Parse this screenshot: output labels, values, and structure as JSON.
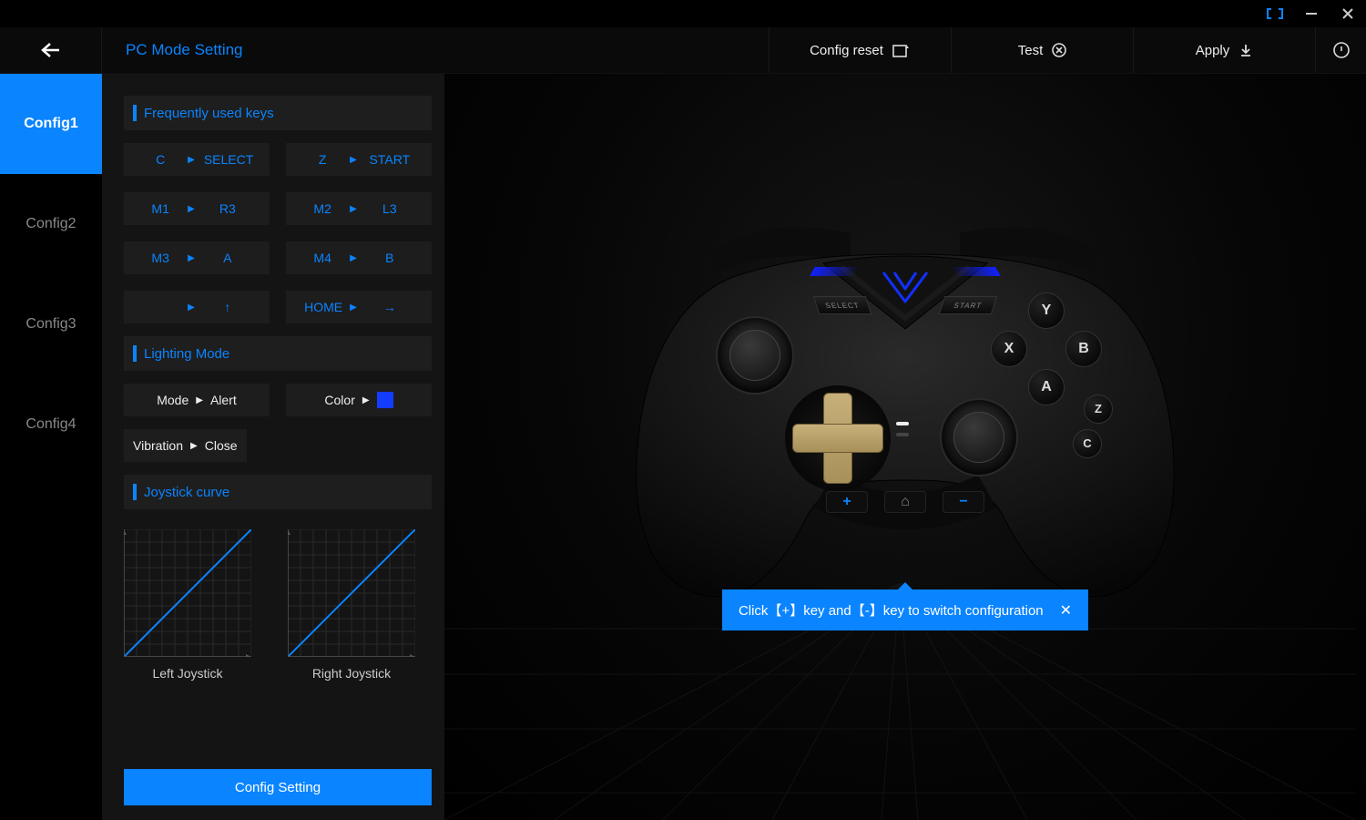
{
  "window": {
    "link_icon": "link-icon",
    "minimize_icon": "minimize-icon",
    "close_icon": "close-icon"
  },
  "header": {
    "title": "PC Mode Setting",
    "config_reset": "Config reset",
    "test": "Test",
    "apply": "Apply"
  },
  "tabs": [
    {
      "label": "Config1",
      "active": true
    },
    {
      "label": "Config2",
      "active": false
    },
    {
      "label": "Config3",
      "active": false
    },
    {
      "label": "Config4",
      "active": false
    }
  ],
  "sections": {
    "freq_keys": "Frequently used keys",
    "lighting": "Lighting Mode",
    "joystick": "Joystick curve"
  },
  "keymaps": [
    {
      "key": "C",
      "val": "SELECT"
    },
    {
      "key": "Z",
      "val": "START"
    },
    {
      "key": "M1",
      "val": "R3"
    },
    {
      "key": "M2",
      "val": "L3"
    },
    {
      "key": "M3",
      "val": "A"
    },
    {
      "key": "M4",
      "val": "B"
    },
    {
      "key": "",
      "val": "↑"
    },
    {
      "key": "HOME",
      "val": "→"
    }
  ],
  "lighting": {
    "mode_label": "Mode",
    "mode_value": "Alert",
    "color_label": "Color",
    "color_hex": "#143cff",
    "vibration_label": "Vibration",
    "vibration_value": "Close"
  },
  "curves": {
    "left_label": "Left Joystick",
    "right_label": "Right Joystick"
  },
  "config_setting_button": "Config Setting",
  "tooltip": {
    "text": "Click【+】key and【-】key to switch configuration",
    "close": "✕"
  },
  "controller": {
    "buttons": {
      "y": "Y",
      "x": "X",
      "b": "B",
      "a": "A",
      "z": "Z",
      "c": "C"
    },
    "strip": {
      "plus": "+",
      "home": "⌂",
      "minus": "−"
    },
    "select": "SELECT",
    "start": "START"
  }
}
